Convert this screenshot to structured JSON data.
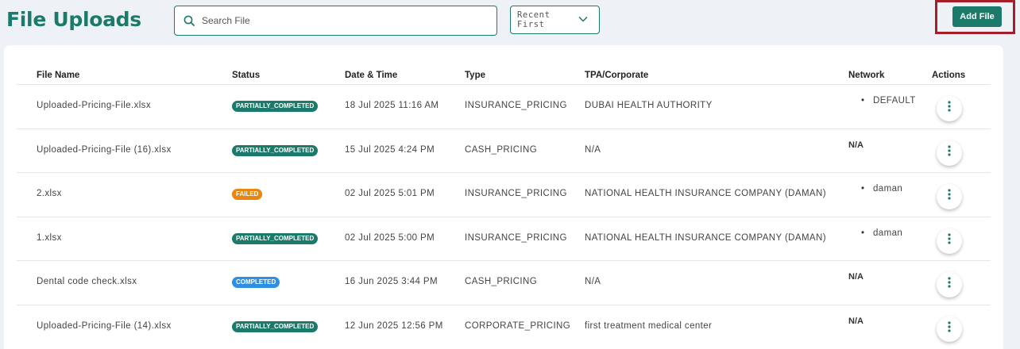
{
  "page": {
    "title": "File Uploads"
  },
  "search": {
    "placeholder": "Search File"
  },
  "sort": {
    "label": "Recent First"
  },
  "add_file": {
    "label": "Add File"
  },
  "colors": {
    "brand": "#1b7a69",
    "highlight": "#a51e2a",
    "status_partial": "#1b7a69",
    "status_failed": "#e8860e",
    "status_completed": "#2f8fe3"
  },
  "table": {
    "columns": [
      "File Name",
      "Status",
      "Date & Time",
      "Type",
      "TPA/Corporate",
      "Network",
      "Actions"
    ],
    "rows": [
      {
        "file": "Uploaded-Pricing-File.xlsx",
        "status": "PARTIALLY_COMPLETED",
        "status_kind": "partial",
        "date": "18 Jul 2025 11:16 AM",
        "type": "INSURANCE_PRICING",
        "tpa": "DUBAI HEALTH AUTHORITY",
        "network": [
          "DEFAULT"
        ]
      },
      {
        "file": "Uploaded-Pricing-File (16).xlsx",
        "status": "PARTIALLY_COMPLETED",
        "status_kind": "partial",
        "date": "15 Jul 2025 4:24 PM",
        "type": "CASH_PRICING",
        "tpa": "N/A",
        "network": "N/A"
      },
      {
        "file": "2.xlsx",
        "status": "FAILED",
        "status_kind": "failed",
        "date": "02 Jul 2025 5:01 PM",
        "type": "INSURANCE_PRICING",
        "tpa": "NATIONAL HEALTH INSURANCE COMPANY (DAMAN)",
        "network": [
          "daman"
        ]
      },
      {
        "file": "1.xlsx",
        "status": "PARTIALLY_COMPLETED",
        "status_kind": "partial",
        "date": "02 Jul 2025 5:00 PM",
        "type": "INSURANCE_PRICING",
        "tpa": "NATIONAL HEALTH INSURANCE COMPANY (DAMAN)",
        "network": [
          "daman"
        ]
      },
      {
        "file": "Dental code check.xlsx",
        "status": "COMPLETED",
        "status_kind": "completed",
        "date": "16 Jun 2025 3:44 PM",
        "type": "CASH_PRICING",
        "tpa": "N/A",
        "network": "N/A"
      },
      {
        "file": "Uploaded-Pricing-File (14).xlsx",
        "status": "PARTIALLY_COMPLETED",
        "status_kind": "partial",
        "date": "12 Jun 2025 12:56 PM",
        "type": "CORPORATE_PRICING",
        "tpa": "first treatment medical center",
        "network": "N/A"
      }
    ]
  }
}
